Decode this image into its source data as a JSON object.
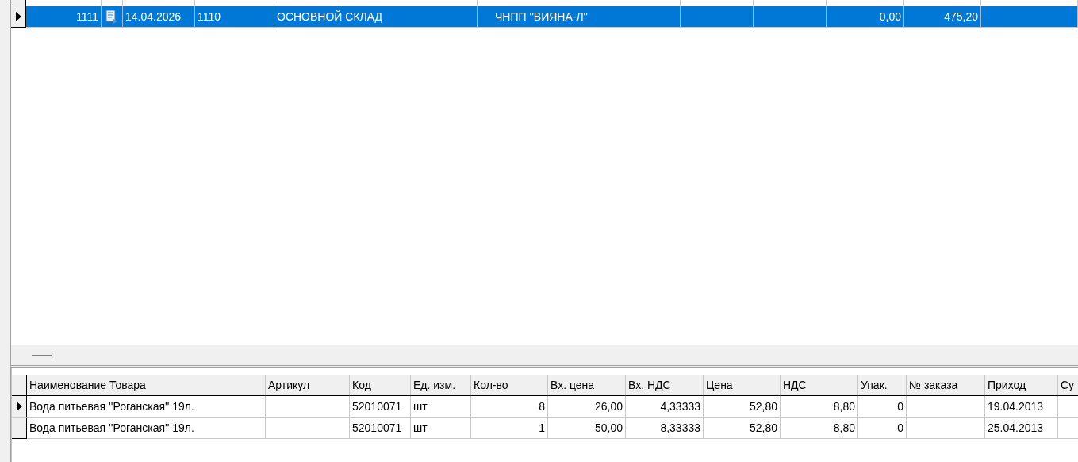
{
  "documents": {
    "rows": [
      {
        "selected": false,
        "partial": true,
        "cells": [
          "",
          "",
          "",
          "",
          "",
          "",
          "",
          "",
          "",
          "",
          ""
        ]
      },
      {
        "selected": true,
        "partial": false,
        "cells": [
          "1111",
          "",
          "14.04.2026",
          "1110",
          "ОСНОВНОЙ СКЛАД",
          "ЧНПП ''ВИЯНА-Л''",
          "",
          "",
          "0,00",
          "475,20",
          ""
        ]
      }
    ]
  },
  "items": {
    "columns": [
      "Наименование Товара",
      "Артикул",
      "Код",
      "Ед. изм.",
      "Кол-во",
      "Вх. цена",
      "Вх. НДС",
      "Цена",
      "НДС",
      "Упак.",
      "№ заказа",
      "Приход",
      "Су"
    ],
    "rows": [
      {
        "selected": true,
        "cells": [
          "Вода питьевая ''Роганская'' 19л.",
          "",
          "52010071",
          "шт",
          "8",
          "26,00",
          "4,33333",
          "52,80",
          "8,80",
          "0",
          "",
          "19.04.2013",
          ""
        ]
      },
      {
        "selected": false,
        "cells": [
          "Вода питьевая ''Роганская'' 19л.",
          "",
          "52010071",
          "шт",
          "1",
          "50,00",
          "8,33333",
          "52,80",
          "8,80",
          "0",
          "",
          "25.04.2013",
          ""
        ]
      }
    ]
  }
}
